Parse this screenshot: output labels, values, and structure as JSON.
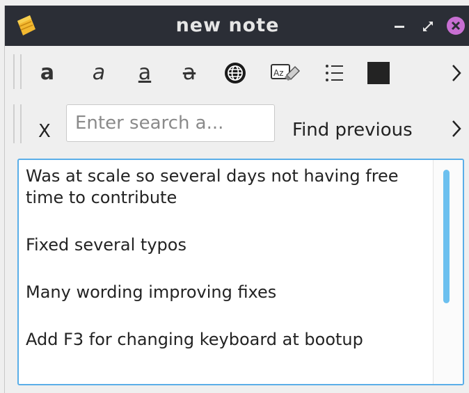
{
  "window": {
    "title": "new note"
  },
  "toolbar": {
    "bold_glyph": "a",
    "italic_glyph": "a",
    "underline_glyph": "a",
    "strike_glyph": "a"
  },
  "findbar": {
    "close_label": "X",
    "search_placeholder": "Enter search a...",
    "search_value": "",
    "find_previous_label": "Find previous"
  },
  "editor": {
    "paragraphs": [
      "Was at scale so several days not having free time to contribute",
      "Fixed several typos",
      "Many wording improving fixes",
      "Add F3 for changing keyboard at bootup"
    ]
  },
  "colors": {
    "titlebar": "#2b2e36",
    "accent": "#5aaee8",
    "close_button": "#c86fd3",
    "scroll_thumb": "#6cc0ef"
  }
}
